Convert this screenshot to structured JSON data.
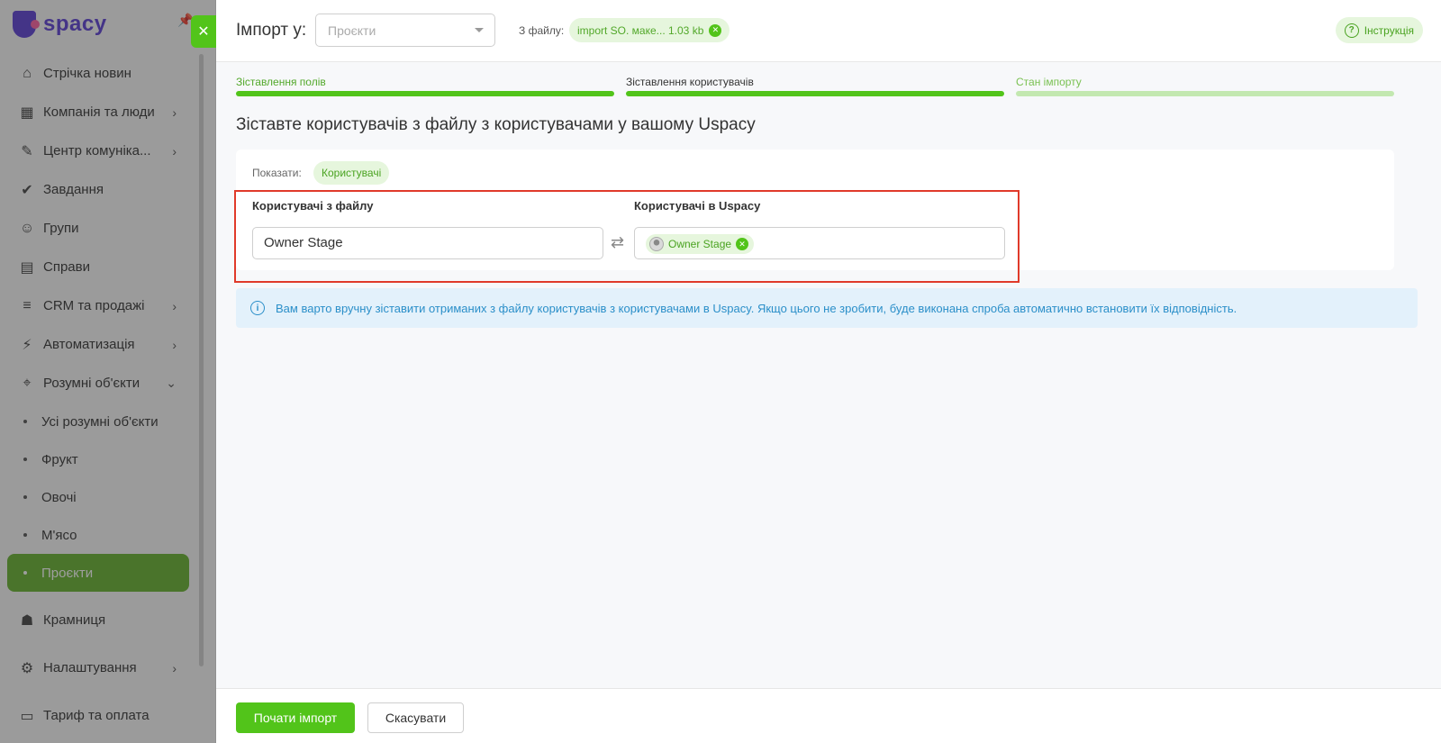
{
  "sidebar": {
    "logo_text": "spacy",
    "items": [
      {
        "label": "Стрічка новин",
        "icon": "home-icon"
      },
      {
        "label": "Компанія та люди",
        "icon": "company-icon",
        "chevron": true
      },
      {
        "label": "Центр комуніка...",
        "icon": "edit-icon",
        "chevron": true
      },
      {
        "label": "Завдання",
        "icon": "check-circle-icon"
      },
      {
        "label": "Групи",
        "icon": "users-icon"
      },
      {
        "label": "Справи",
        "icon": "calendar-icon"
      },
      {
        "label": "CRM та продажі",
        "icon": "database-icon",
        "chevron": true
      },
      {
        "label": "Автоматизація",
        "icon": "lightning-icon",
        "chevron": true
      },
      {
        "label": "Розумні об'єкти",
        "icon": "scan-icon",
        "chevron": true
      }
    ],
    "subitems": [
      "Усі розумні об'єкти",
      "Фрукт",
      "Овочі",
      "М'ясо",
      "Проєкти"
    ],
    "active_subitem": "Проєкти",
    "bottom_items": [
      {
        "label": "Крамниця",
        "icon": "store-icon"
      },
      {
        "label": "Налаштування",
        "icon": "gear-icon",
        "chevron": true
      },
      {
        "label": "Тариф та оплата",
        "icon": "payment-icon"
      }
    ]
  },
  "header": {
    "title": "Імпорт у:",
    "select_value": "Проєкти",
    "file_label": "З файлу:",
    "file_chip": "import SO. маке... 1.03 kb",
    "help_label": "Інструкція"
  },
  "steps": [
    {
      "label": "Зіставлення полів",
      "state": "done"
    },
    {
      "label": "Зіставлення користувачів",
      "state": "current"
    },
    {
      "label": "Стан імпорту",
      "state": "pending"
    }
  ],
  "main": {
    "heading": "Зіставте користувачів з файлу з користувачами у вашому Uspacy",
    "show_label": "Показати:",
    "show_chip": "Користувачі",
    "left_header": "Користувачі з файлу",
    "right_header": "Користувачі в Uspacy",
    "file_user_value": "Owner Stage",
    "uspacy_user_chip": "Owner Stage",
    "info_text": "Вам варто вручну зіставити отриманих з файлу користувачів з користувачами в Uspacy. Якщо цього не зробити, буде виконана спроба автоматично встановити їх відповідність."
  },
  "footer": {
    "primary_label": "Почати імпорт",
    "secondary_label": "Скасувати"
  },
  "colors": {
    "accent": "#52c41a",
    "highlight": "#e03a2a",
    "info": "#2b8fc9",
    "logo": "#5b3fd6"
  }
}
